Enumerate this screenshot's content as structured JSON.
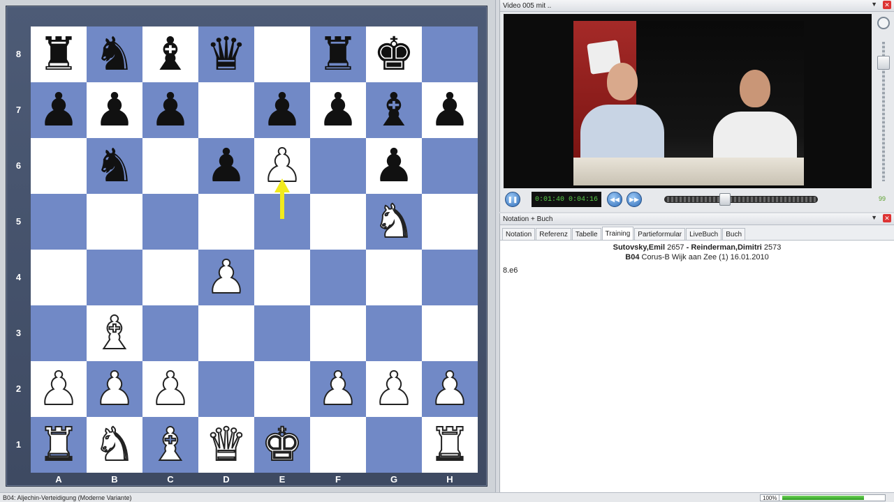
{
  "board": {
    "files": [
      "A",
      "B",
      "C",
      "D",
      "E",
      "F",
      "G",
      "H"
    ],
    "ranks": [
      "8",
      "7",
      "6",
      "5",
      "4",
      "3",
      "2",
      "1"
    ],
    "position": [
      [
        "bR",
        "bN",
        "bB",
        "bQ",
        "",
        "bR",
        "bK",
        ""
      ],
      [
        "bP",
        "bP",
        "bP",
        "",
        "bP",
        "bP",
        "bB",
        "bP"
      ],
      [
        "",
        "bN",
        "",
        "bP",
        "wP",
        "",
        "bP",
        ""
      ],
      [
        "",
        "",
        "",
        "",
        "",
        "",
        "wN",
        ""
      ],
      [
        "",
        "",
        "",
        "wP",
        "",
        "",
        "",
        ""
      ],
      [
        "",
        "wB",
        "",
        "",
        "",
        "",
        "",
        ""
      ],
      [
        "wP",
        "wP",
        "wP",
        "",
        "",
        "wP",
        "wP",
        "wP"
      ],
      [
        "wR",
        "wN",
        "wB",
        "wQ",
        "wK",
        "",
        "",
        "wR"
      ]
    ],
    "last_move": {
      "from": "e5",
      "to": "e6",
      "arrow_color": "#f2ea1c"
    },
    "colors": {
      "light": "#ffffff",
      "dark": "#7189c6",
      "frame": "#46536d"
    }
  },
  "video_panel": {
    "title": "Video 005 mit ..",
    "time_current": "0:01:40",
    "time_total": "0:04:16",
    "progress": 0.39,
    "volume": "99"
  },
  "notation_panel": {
    "title": "Notation + Buch",
    "tabs": [
      {
        "label": "Notation",
        "active": false
      },
      {
        "label": "Referenz",
        "active": false
      },
      {
        "label": "Tabelle",
        "active": false
      },
      {
        "label": "Training",
        "active": true
      },
      {
        "label": "Partieformular",
        "active": false
      },
      {
        "label": "LiveBuch",
        "active": false
      },
      {
        "label": "Buch",
        "active": false
      }
    ],
    "white_player": "Sutovsky,Emil",
    "white_elo": "2657",
    "separator": "-",
    "black_player": "Reinderman,Dimitri",
    "black_elo": "2573",
    "eco": "B04",
    "event": "Corus-B Wijk aan Zee (1) 16.01.2010",
    "moves": "8.e6"
  },
  "status_bar": {
    "opening": "B04: Aljechin-Verteidigung (Moderne Variante)",
    "zoom": "100%",
    "zoom_fill": 0.82
  },
  "controls": {
    "pin": "▼",
    "close": "✕"
  }
}
